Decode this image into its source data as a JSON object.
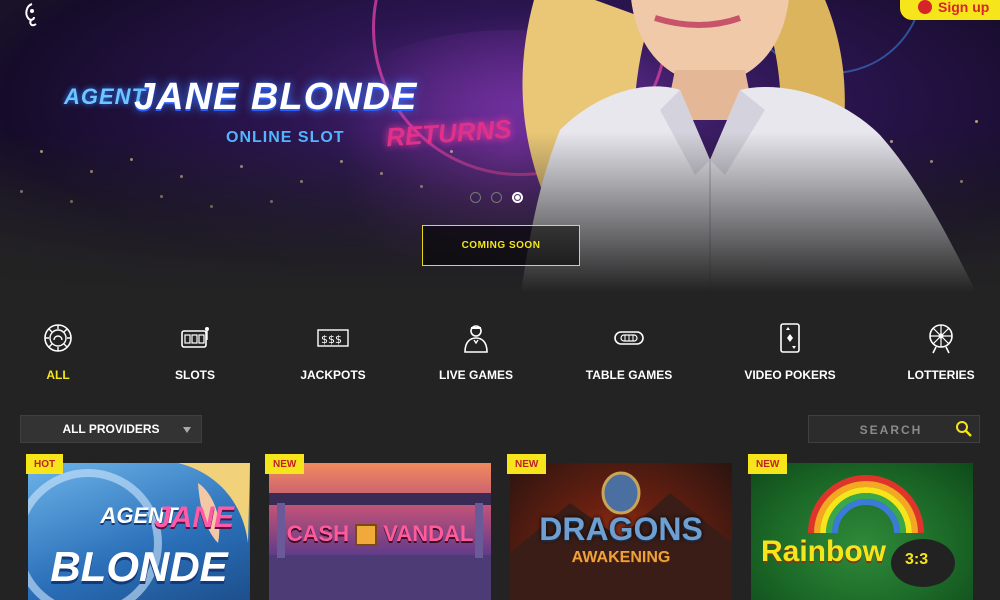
{
  "header": {
    "signup_label": "Sign up"
  },
  "hero": {
    "title_prefix": "AGENT",
    "title_main": "JANE BLONDE",
    "subtitle": "ONLINE SLOT",
    "title_suffix": "RETURNS",
    "cta_label": "COMING SOON",
    "slides_total": 3,
    "active_slide": 3
  },
  "categories": [
    {
      "label": "ALL",
      "icon": "chip-icon",
      "active": true
    },
    {
      "label": "SLOTS",
      "icon": "slot-machine-icon",
      "active": false
    },
    {
      "label": "JACKPOTS",
      "icon": "dollar-signs-icon",
      "active": false
    },
    {
      "label": "LIVE GAMES",
      "icon": "dealer-icon",
      "active": false
    },
    {
      "label": "TABLE GAMES",
      "icon": "table-icon",
      "active": false
    },
    {
      "label": "VIDEO POKERS",
      "icon": "playing-card-icon",
      "active": false
    },
    {
      "label": "LOTTERIES",
      "icon": "wheel-icon",
      "active": false
    }
  ],
  "filters": {
    "provider_label": "ALL PROVIDERS",
    "search_placeholder": "SEARCH"
  },
  "games": [
    {
      "badge": "HOT",
      "title_line1": "AGENT",
      "title_line2": "JANE",
      "title_line3": "BLONDE"
    },
    {
      "badge": "NEW",
      "title_part1": "CASH",
      "title_part2": "VANDAL"
    },
    {
      "badge": "NEW",
      "title_line1": "DRAGONS",
      "title_line2": "AWAKENING"
    },
    {
      "badge": "NEW",
      "title_main": "Rainbow",
      "title_suffix": "3:3"
    }
  ],
  "colors": {
    "accent": "#f5e51a",
    "badge_text": "#c2202a",
    "background": "#232323"
  }
}
